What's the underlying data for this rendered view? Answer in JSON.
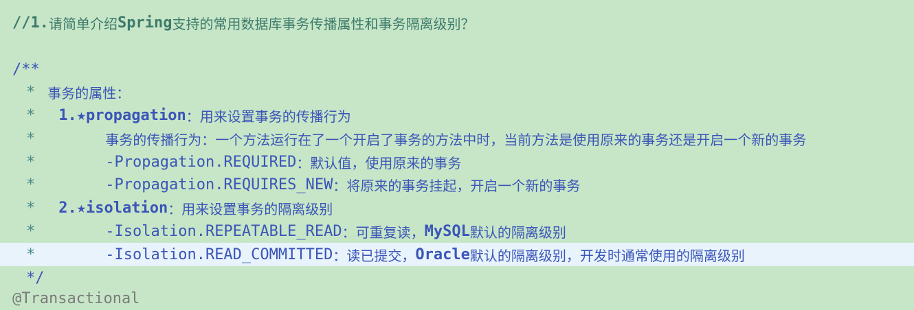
{
  "editor": {
    "colors": {
      "background": "#c7e6c7",
      "highlight_line": "#e8f3fb",
      "comment_green": "#3d7a6b",
      "javadoc_blue": "#3b55b8"
    },
    "line1": {
      "prefix": "//1.",
      "t1": "请简单介绍",
      "t2": "Spring",
      "t3": "支持的常用数据库事务传播属性和事务隔离级别？"
    },
    "line2": {
      "text": "/**"
    },
    "line3": {
      "star": "*",
      "text": "事务的属性："
    },
    "line4": {
      "star": "*",
      "num": "1.★",
      "key": "propagation",
      "desc": "：用来设置事务的传播行为"
    },
    "line5": {
      "star": "*",
      "desc": "事务的传播行为：一个方法运行在了一个开启了事务的方法中时，当前方法是使用原来的事务还是开启一个新的事务"
    },
    "line6": {
      "star": "*",
      "key": "-Propagation.REQUIRED",
      "desc": "：默认值，使用原来的事务"
    },
    "line7": {
      "star": "*",
      "key": "-Propagation.REQUIRES_NEW",
      "desc": "：将原来的事务挂起，开启一个新的事务"
    },
    "line8": {
      "star": "*",
      "num": "2.★",
      "key": "isolation",
      "desc": "：用来设置事务的隔离级别"
    },
    "line9": {
      "star": "*",
      "key": "-Isolation.REPEATABLE_READ",
      "desc1": "：可重复读，",
      "em": "MySQL",
      "desc2": "默认的隔离级别"
    },
    "line10": {
      "star": "*",
      "key": "-Isolation.READ_COMMITTED",
      "desc1": "：读已提交，",
      "em": "Oracle",
      "desc2": "默认的隔离级别，开发时通常使用的隔离级别"
    },
    "line11": {
      "text": "*/"
    },
    "line12": {
      "text": "@Transactional"
    }
  }
}
